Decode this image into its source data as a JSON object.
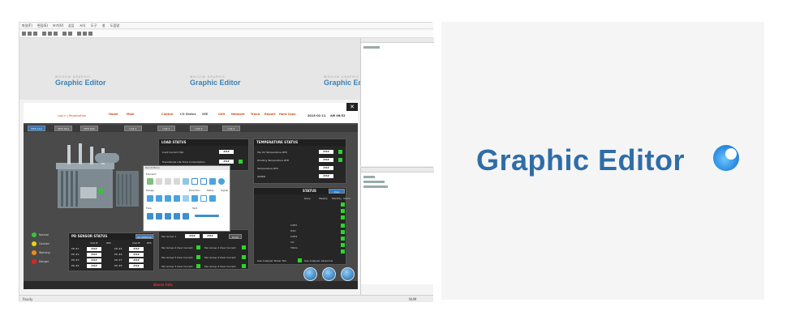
{
  "logo": {
    "text": "Graphic Editor",
    "watermark_brand": "WOOJIN GRAPHIC"
  },
  "editor": {
    "menu": [
      "파일(F)",
      "편집(E)",
      "보기(V)",
      "삽입",
      "서식",
      "도구",
      "창",
      "도움말"
    ],
    "watermark_logo": "Graphic Editor"
  },
  "scada": {
    "login": "Log In | Registration",
    "nav": [
      "Home",
      "Main",
      "Control",
      "I/O Status",
      "SEE",
      "Unit",
      "Network",
      "Trend",
      "Report",
      "Hard Copy"
    ],
    "date": "2013-01-11",
    "time": "AM 08:52",
    "tabs": [
      "MTR 1&2",
      "MTR 3&4",
      "MTR 5&6",
      "Unit 1",
      "Unit 2",
      "Unit 3",
      "Unit 4"
    ],
    "load_status": {
      "title": "LOAD STATUS",
      "rows": [
        "Load Current Hph",
        "Transitional Life Time Consumption"
      ]
    },
    "temperature_status": {
      "title": "TEMPERATURE STATUS",
      "rows": [
        "Top Oil Temperature RTD",
        "Winding Temperature RTD",
        "Temperature RTD",
        "OIMER"
      ]
    },
    "gas_status": {
      "title": "STATUS",
      "button": "DGA",
      "headers": [
        "Daily",
        "Weekly",
        "Monthly",
        "Alarm"
      ],
      "rows": [
        "C2H2",
        "H2O",
        "C2H4",
        "CO",
        "TDCG"
      ]
    },
    "pd_sensor": {
      "title": "PD SENSOR STATUS",
      "button": "PD SENSOR",
      "headers": [
        "VALUE",
        "RPS",
        "VALUE",
        "RPS"
      ],
      "rows_left": [
        "PD #1",
        "PD #2",
        "PD #3",
        "PD #4"
      ],
      "rows_right": [
        "PD #5",
        "PD #6",
        "PD #7",
        "PD #8"
      ]
    },
    "fan_group": {
      "rows": [
        "Fan Group 1",
        "Fan Group 2 Over Current",
        "Fan Group 3 Over Current"
      ],
      "rows_right": [
        "Fan Group 2 Over Current",
        "Fan Group 4 Over Current",
        "Fan Group 4 Over Current"
      ],
      "stop": "STOP"
    },
    "gas_alarm": [
      "Gas Analyzer Power Fail",
      "Gas Analyzer Abnormal"
    ],
    "legend": [
      "Normal",
      "Caution",
      "Warning",
      "Danger"
    ],
    "value_placeholder": "###",
    "status_text": "Alarm Info",
    "colors": {
      "normal": "#3cc23c",
      "caution": "#e8d21c",
      "warning": "#f08a1a",
      "danger": "#e0231e"
    }
  },
  "popup": {
    "title": "Quick Menu",
    "sections": [
      "Element",
      "Design",
      "Direction",
      "Meter",
      "Signal",
      "Flow",
      "Text"
    ]
  },
  "status": {
    "left": "Ready",
    "right": "NUM"
  },
  "colors": {
    "brand_blue": "#2f6da8",
    "accent": "#2f78c5"
  }
}
